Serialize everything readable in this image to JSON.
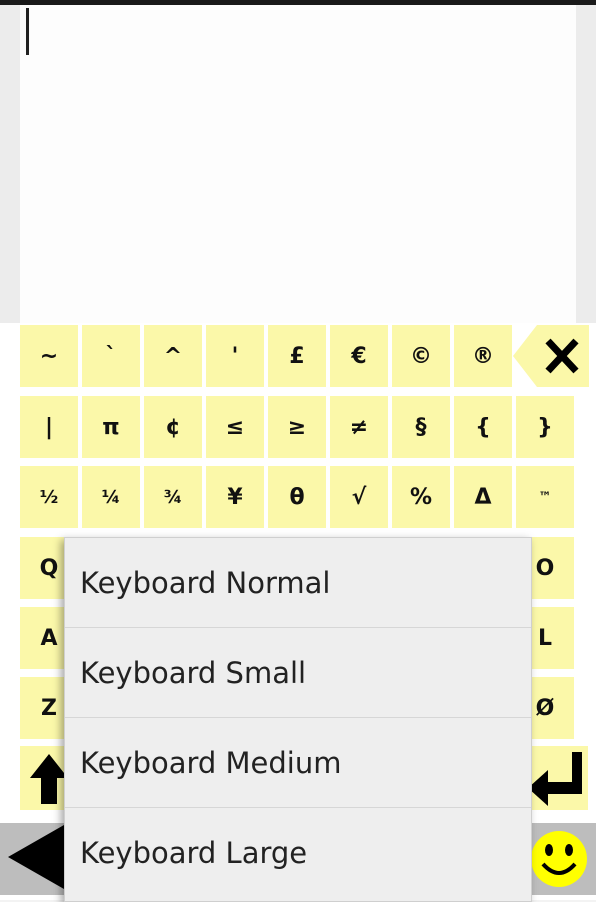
{
  "text_editor": {
    "content": ""
  },
  "keys": {
    "row1": [
      "~",
      "`",
      "^",
      "'",
      "£",
      "€",
      "©",
      "®"
    ],
    "row2": [
      "|",
      "π",
      "¢",
      "≤",
      "≥",
      "≠",
      "§",
      "{",
      "}"
    ],
    "row3": [
      "½",
      "¼",
      "¾",
      "¥",
      "θ",
      "√",
      "%",
      "Δ",
      "™"
    ],
    "left_col": [
      "Q",
      "A",
      "Z"
    ],
    "right_col": [
      "O",
      "L",
      "Ø"
    ]
  },
  "menu": {
    "items": [
      "Keyboard Normal",
      "Keyboard Small",
      "Keyboard Medium",
      "Keyboard Large"
    ]
  },
  "colors": {
    "key_bg": "#fbf8a9",
    "smiley": "#ffff00",
    "menu_bg": "#eeeeee"
  },
  "icons": {
    "delete": "backspace-x-icon",
    "shift": "shift-arrow-up-icon",
    "enter": "enter-arrow-icon",
    "back": "back-triangle-icon",
    "emoji": "smiley-icon"
  }
}
